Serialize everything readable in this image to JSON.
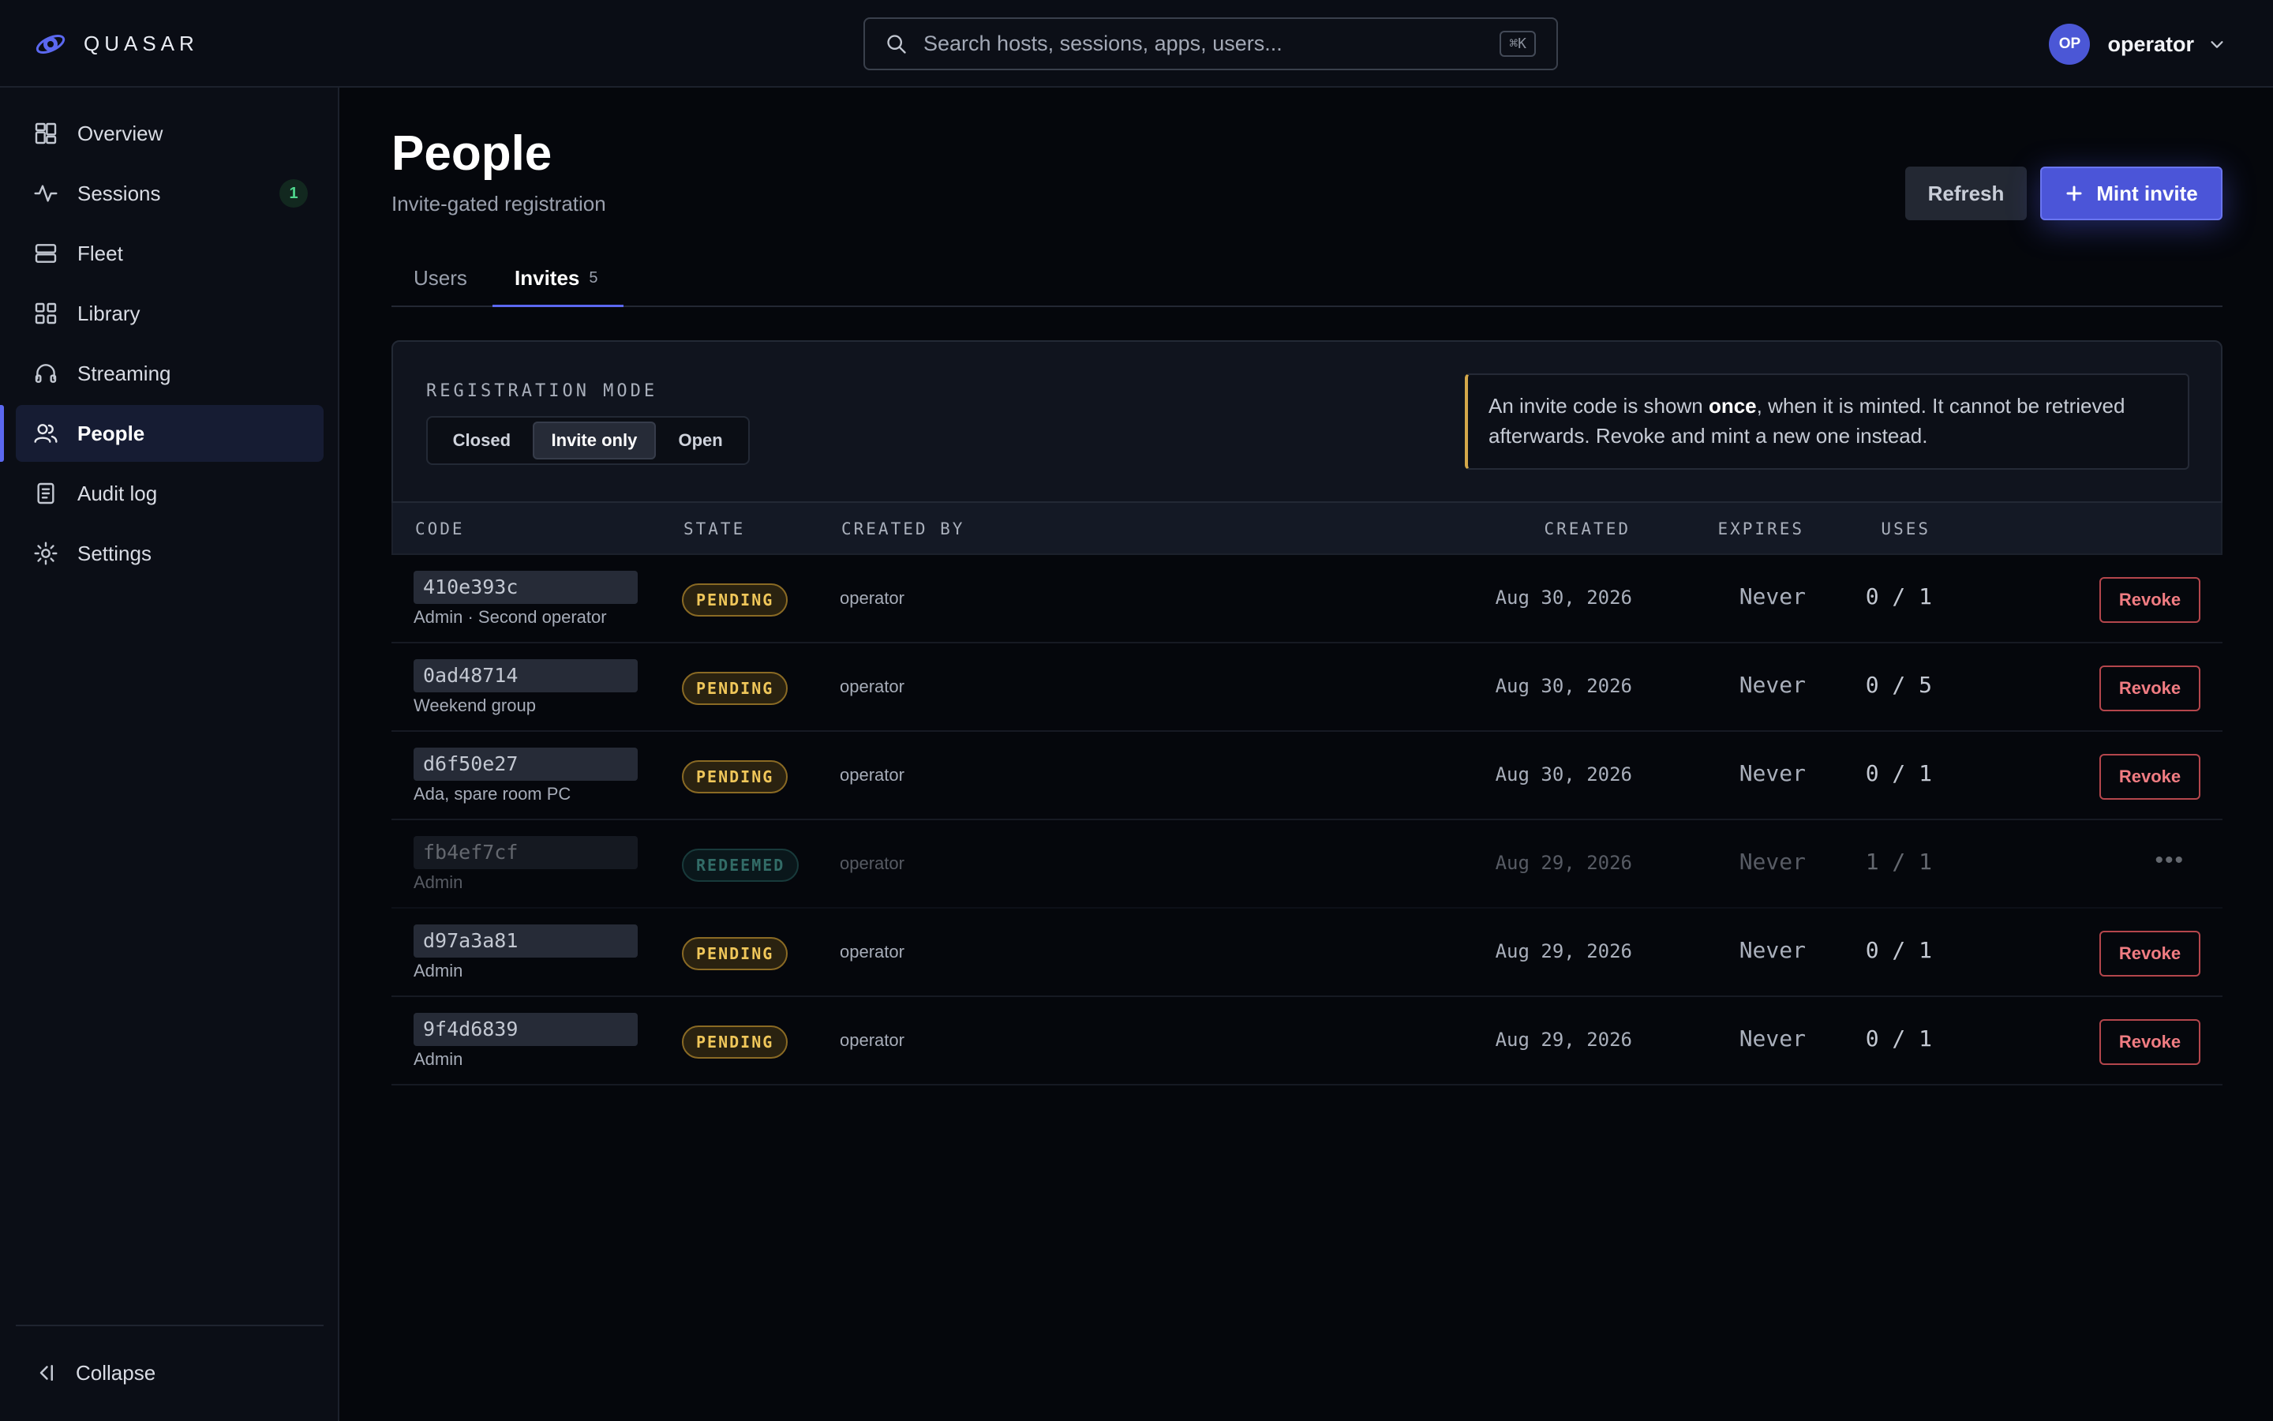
{
  "app": {
    "name": "QUASAR"
  },
  "search": {
    "placeholder": "Search hosts, sessions, apps, users...",
    "shortcut": "⌘K"
  },
  "user": {
    "initials": "OP",
    "name": "operator"
  },
  "sidebar": {
    "items": [
      {
        "label": "Overview",
        "icon": "overview-icon"
      },
      {
        "label": "Sessions",
        "icon": "activity-icon",
        "badge": "1"
      },
      {
        "label": "Fleet",
        "icon": "server-icon"
      },
      {
        "label": "Library",
        "icon": "grid-icon"
      },
      {
        "label": "Streaming",
        "icon": "headphones-icon"
      },
      {
        "label": "People",
        "icon": "users-icon",
        "active": true
      },
      {
        "label": "Audit log",
        "icon": "document-icon"
      },
      {
        "label": "Settings",
        "icon": "gear-icon"
      }
    ],
    "collapse_label": "Collapse"
  },
  "page": {
    "title": "People",
    "subtitle": "Invite-gated registration",
    "refresh_label": "Refresh",
    "mint_label": "Mint invite"
  },
  "tabs": {
    "users": "Users",
    "invites": "Invites",
    "invites_count": "5"
  },
  "registration": {
    "label": "REGISTRATION MODE",
    "options": [
      "Closed",
      "Invite only",
      "Open"
    ],
    "selected": "Invite only",
    "notice_pre": "An invite code is shown ",
    "notice_bold": "once",
    "notice_post": ", when it is minted. It cannot be retrieved afterwards. Revoke and mint a new one instead."
  },
  "table": {
    "headers": {
      "code": "CODE",
      "state": "STATE",
      "created_by": "CREATED BY",
      "created": "CREATED",
      "expires": "EXPIRES",
      "uses": "USES"
    },
    "revoke_label": "Revoke",
    "more_label": "•••",
    "rows": [
      {
        "code": "410e393c",
        "note": "Admin · Second operator",
        "state": "PENDING",
        "created_by": "operator",
        "created": "Aug 30, 2026",
        "expires": "Never",
        "uses": "0 / 1"
      },
      {
        "code": "0ad48714",
        "note": "Weekend group",
        "state": "PENDING",
        "created_by": "operator",
        "created": "Aug 30, 2026",
        "expires": "Never",
        "uses": "0 / 5"
      },
      {
        "code": "d6f50e27",
        "note": "Ada, spare room PC",
        "state": "PENDING",
        "created_by": "operator",
        "created": "Aug 30, 2026",
        "expires": "Never",
        "uses": "0 / 1"
      },
      {
        "code": "fb4ef7cf",
        "note": "Admin",
        "state": "REDEEMED",
        "created_by": "operator",
        "created": "Aug 29, 2026",
        "expires": "Never",
        "uses": "1 / 1"
      },
      {
        "code": "d97a3a81",
        "note": "Admin",
        "state": "PENDING",
        "created_by": "operator",
        "created": "Aug 29, 2026",
        "expires": "Never",
        "uses": "0 / 1"
      },
      {
        "code": "9f4d6839",
        "note": "Admin",
        "state": "PENDING",
        "created_by": "operator",
        "created": "Aug 29, 2026",
        "expires": "Never",
        "uses": "0 / 1"
      }
    ]
  },
  "colors": {
    "accent": "#4b55d8",
    "pending": "#f0c75a",
    "redeemed": "#5fd1c2",
    "danger": "#f07c82"
  }
}
